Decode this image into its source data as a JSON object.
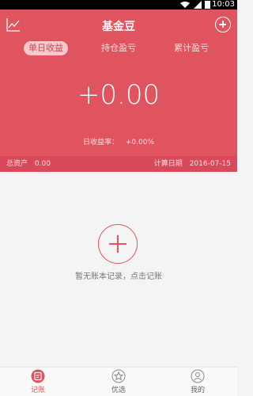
{
  "status_bar": {
    "time": "10:03"
  },
  "header": {
    "title": "基金豆",
    "tabs": [
      {
        "label": "单日收益",
        "active": true
      },
      {
        "label": "持仓盈亏",
        "active": false
      },
      {
        "label": "累计盈亏",
        "active": false
      }
    ],
    "value": "+0.00",
    "rate_label": "日收益率：",
    "rate_value": "+0.00%",
    "total_assets_label": "总资产",
    "total_assets_value": "0.00",
    "calc_date_label": "计算日期",
    "calc_date_value": "2016-07-15"
  },
  "empty_state": {
    "message": "暂无账本记录，点击记账"
  },
  "bottom_nav": {
    "items": [
      {
        "label": "记账",
        "icon": "notebook-icon",
        "active": true
      },
      {
        "label": "优选",
        "icon": "star-icon",
        "active": false
      },
      {
        "label": "我的",
        "icon": "profile-icon",
        "active": false
      }
    ]
  },
  "colors": {
    "primary": "#e0545f",
    "primary_dark": "#d8495a",
    "background": "#f4f4f4"
  }
}
